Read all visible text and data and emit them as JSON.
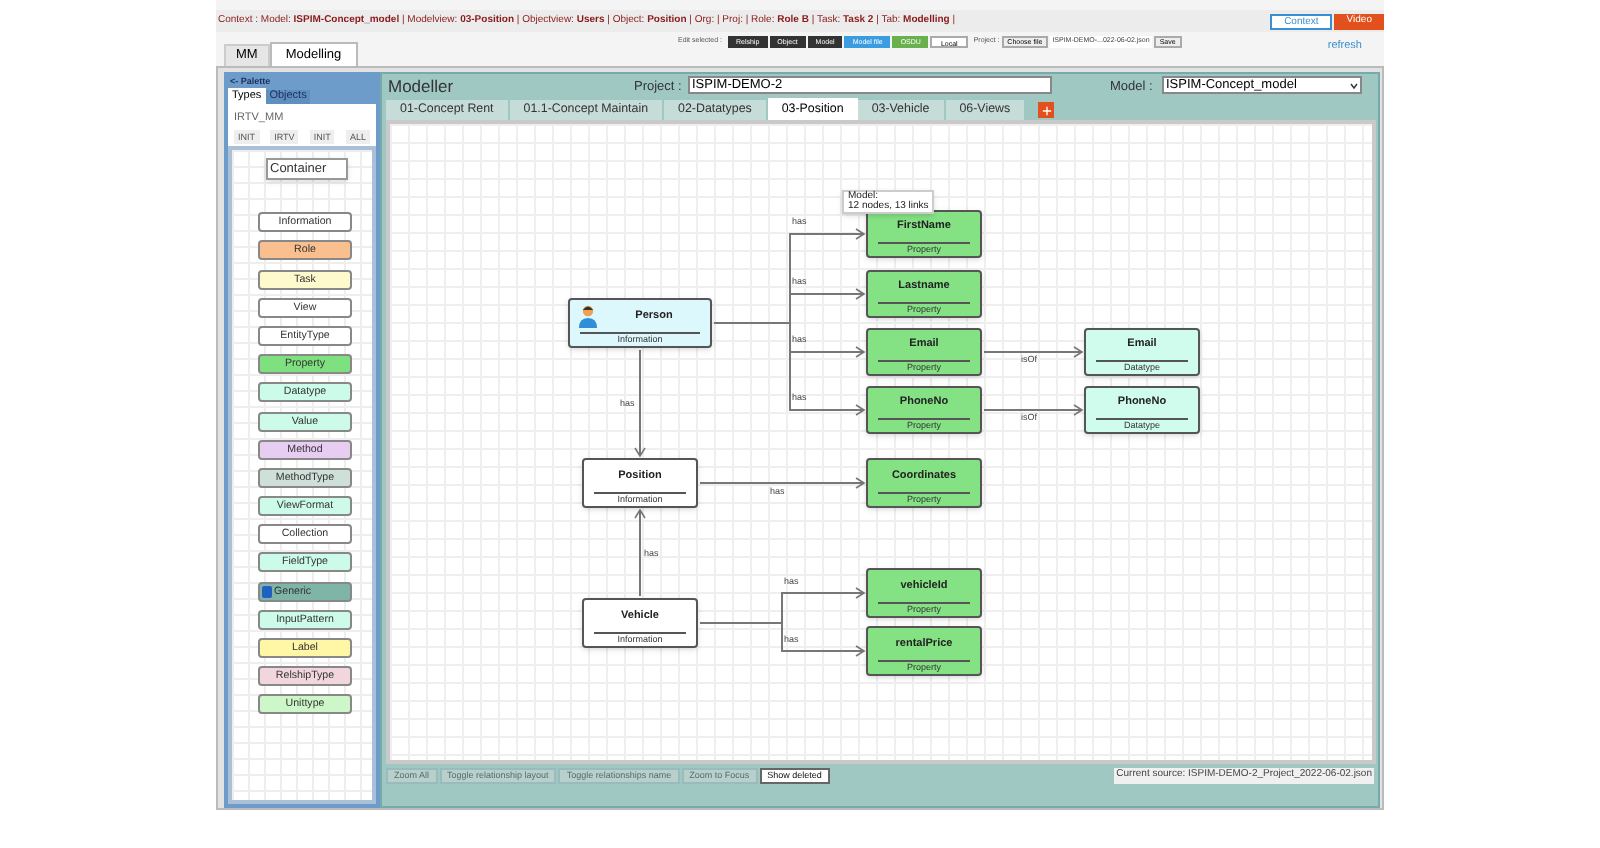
{
  "context_bar": {
    "text": "Context : Model: **ISPIM-Concept_model** | Modelview: **03-Position** | Objectview: **Users** | Object: **Position** | Org: | Proj: | Role: **Role B** | Task: **Task 2** | Tab: **Modelling** |",
    "buttons": [
      {
        "label": "Context",
        "kind": "outline"
      },
      {
        "label": "Video",
        "kind": "filled"
      }
    ]
  },
  "main_tabs": [
    {
      "label": "MM",
      "selected": false
    },
    {
      "label": "Modelling",
      "selected": true
    }
  ],
  "toolbar": {
    "edit_label": "Edit selected :",
    "buttons": [
      {
        "label": "Relship",
        "kind": "dark"
      },
      {
        "label": "Object",
        "kind": "dark"
      },
      {
        "label": "Model",
        "kind": "dark"
      },
      {
        "label": "Model file",
        "kind": "blue"
      },
      {
        "label": "OSDU",
        "kind": "green"
      },
      {
        "label": "Local",
        "kind": "light"
      }
    ],
    "project_label": "Project :",
    "choose_file": "Choose file",
    "file_name": "ISPIM-DEMO-...022-06-02.json",
    "save": "Save"
  },
  "refresh": "refresh",
  "palette": {
    "title": "<- Palette",
    "tabs": [
      {
        "label": "Types",
        "selected": true
      },
      {
        "label": "Objects",
        "selected": false
      }
    ],
    "metamodel": "IRTV_MM",
    "filters": [
      "INIT",
      "IRTV",
      "INIT",
      "ALL"
    ],
    "items": [
      {
        "label": "Container",
        "kind": "container",
        "color": "#ffffff"
      },
      {
        "label": "Information",
        "kind": "type",
        "color": "#ffffff"
      },
      {
        "label": "Role",
        "kind": "type",
        "color": "#f9bf8f"
      },
      {
        "label": "Task",
        "kind": "type",
        "color": "#fffacd"
      },
      {
        "label": "View",
        "kind": "type",
        "color": "#ffffff"
      },
      {
        "label": "EntityType",
        "kind": "type",
        "color": "#ffffff"
      },
      {
        "label": "Property",
        "kind": "type",
        "color": "#7ee07e"
      },
      {
        "label": "Datatype",
        "kind": "type",
        "color": "#ccfbea"
      },
      {
        "label": "Value",
        "kind": "type",
        "color": "#ccfbea"
      },
      {
        "label": "Method",
        "kind": "type",
        "color": "#e8cdf2"
      },
      {
        "label": "MethodType",
        "kind": "type",
        "color": "#cfe0d8"
      },
      {
        "label": "ViewFormat",
        "kind": "type",
        "color": "#ccfbea"
      },
      {
        "label": "Collection",
        "kind": "type",
        "color": "#ffffff"
      },
      {
        "label": "FieldType",
        "kind": "type",
        "color": "#ccfbea"
      },
      {
        "label": "Generic",
        "kind": "icon",
        "color": "#7fb5a6"
      },
      {
        "label": "InputPattern",
        "kind": "type",
        "color": "#ccfbea"
      },
      {
        "label": "Label",
        "kind": "type",
        "color": "#fff6a6"
      },
      {
        "label": "RelshipType",
        "kind": "type",
        "color": "#f2d6de"
      },
      {
        "label": "Unittype",
        "kind": "type",
        "color": "#cdf7c8"
      }
    ]
  },
  "modeller": {
    "title": "Modeller",
    "project_label": "Project :",
    "project_value": "ISPIM-DEMO-2",
    "model_label": "Model :",
    "model_value": "ISPIM-Concept_model",
    "tabs": [
      {
        "label": "01-Concept Rent",
        "selected": false
      },
      {
        "label": "01.1-Concept Maintain",
        "selected": false
      },
      {
        "label": "02-Datatypes",
        "selected": false
      },
      {
        "label": "03-Position",
        "selected": true
      },
      {
        "label": "03-Vehicle",
        "selected": false
      },
      {
        "label": "06-Views",
        "selected": false
      }
    ],
    "tooltip": [
      "Model:",
      "12 nodes, 13 links"
    ],
    "nodes": [
      {
        "name": "Person",
        "type": "Information",
        "kind": "icon",
        "color": "#dcf8fc"
      },
      {
        "name": "FirstName",
        "type": "Property",
        "kind": "plain",
        "color": "#84e184"
      },
      {
        "name": "Lastname",
        "type": "Property",
        "kind": "plain",
        "color": "#84e184"
      },
      {
        "name": "Email",
        "type": "Property",
        "kind": "plain",
        "color": "#84e184"
      },
      {
        "name": "PhoneNo",
        "type": "Property",
        "kind": "plain",
        "color": "#84e184"
      },
      {
        "name": "Email",
        "type": "Datatype",
        "kind": "plain",
        "color": "#cffcec"
      },
      {
        "name": "PhoneNo",
        "type": "Datatype",
        "kind": "plain",
        "color": "#cffcec"
      },
      {
        "name": "Position",
        "type": "Information",
        "kind": "plain",
        "color": "#ffffff"
      },
      {
        "name": "Coordinates",
        "type": "Property",
        "kind": "plain",
        "color": "#84e184"
      },
      {
        "name": "Vehicle",
        "type": "Information",
        "kind": "plain",
        "color": "#ffffff"
      },
      {
        "name": "vehicleId",
        "type": "Property",
        "kind": "plain",
        "color": "#84e184"
      },
      {
        "name": "rentalPrice",
        "type": "Property",
        "kind": "plain",
        "color": "#84e184"
      }
    ],
    "links": [
      {
        "label": "has"
      },
      {
        "label": "has"
      },
      {
        "label": "has"
      },
      {
        "label": "has"
      },
      {
        "label": "isOf"
      },
      {
        "label": "isOf"
      },
      {
        "label": "has"
      },
      {
        "label": "has"
      },
      {
        "label": "has"
      },
      {
        "label": "has"
      },
      {
        "label": "has"
      }
    ]
  },
  "bottom_bar": {
    "buttons": [
      {
        "label": "Zoom All",
        "disabled": true
      },
      {
        "label": "Toggle relationship layout",
        "disabled": true
      },
      {
        "label": "Toggle relationships name",
        "disabled": true
      },
      {
        "label": "Zoom to Focus",
        "disabled": true
      },
      {
        "label": "Show deleted",
        "disabled": false
      }
    ],
    "source": "Current source: ISPIM-DEMO-2_Project_2022-06-02.json"
  }
}
